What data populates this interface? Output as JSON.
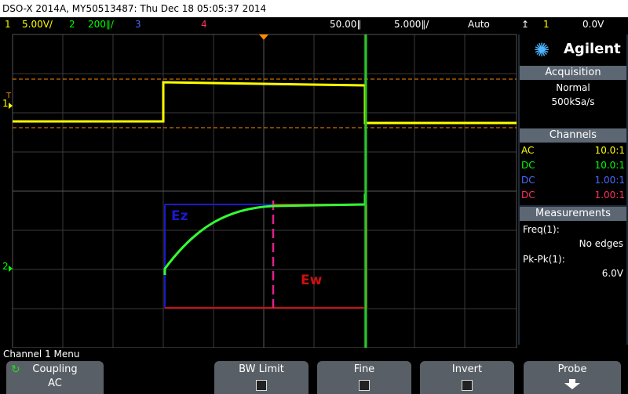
{
  "title": "DSO-X 2014A, MY50513487: Thu Dec 18 05:05:37 2014",
  "status": {
    "ch1_num": "1",
    "ch1_scale": "5.00V/",
    "ch2_num": "2",
    "ch2_scale": "200∥/",
    "ch3_num": "3",
    "ch4_num": "4",
    "delay": "50.00∥",
    "timebase": "5.000∥/",
    "trigger_mode": "Auto",
    "trigger_source": "1",
    "trigger_level": "0.0V"
  },
  "panel": {
    "brand": "Agilent",
    "acquisition_title": "Acquisition",
    "acquisition_mode": "Normal",
    "sample_rate": "500kSa/s",
    "channels_title": "Channels",
    "channels": [
      {
        "coupling": "AC",
        "probe": "10.0:1",
        "color": "#ffff00"
      },
      {
        "coupling": "DC",
        "probe": "10.0:1",
        "color": "#00ff00"
      },
      {
        "coupling": "DC",
        "probe": "1.00:1",
        "color": "#4a6aff"
      },
      {
        "coupling": "DC",
        "probe": "1.00:1",
        "color": "#ff3060"
      }
    ],
    "measurements_title": "Measurements",
    "meas1_label": "Freq(1):",
    "meas1_value": "No edges",
    "meas2_label": "Pk-Pk(1):",
    "meas2_value": "6.0V"
  },
  "annotations": {
    "ez": "Ez",
    "ew": "Ew"
  },
  "markers": {
    "ch1": "1",
    "ch2": "2",
    "trigger_t": "T"
  },
  "menu": {
    "label": "Channel 1 Menu",
    "softkeys": [
      {
        "label": "Coupling",
        "value": "AC"
      },
      {
        "label": "BW Limit"
      },
      {
        "label": "Fine"
      },
      {
        "label": "Invert"
      },
      {
        "label": "Probe"
      }
    ]
  },
  "colors": {
    "ch1": "#ffff00",
    "ch2": "#00ff00",
    "ch3": "#4a6aff",
    "ch4": "#ff3060",
    "ez": "#1a1acc",
    "ew": "#cc1010",
    "accent_orange": "#ff8a00"
  }
}
